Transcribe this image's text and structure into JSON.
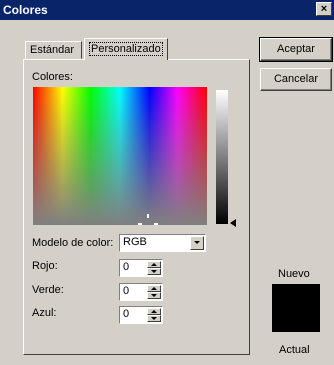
{
  "window": {
    "title": "Colores",
    "close_glyph": "×"
  },
  "tabs": [
    {
      "label": "Estándar",
      "active": false
    },
    {
      "label": "Personalizado",
      "active": true
    }
  ],
  "custom": {
    "colors_label": "Colores:",
    "model_label": "Modelo de color:",
    "model_value": "RGB",
    "red_label": "Rojo:",
    "green_label": "Verde:",
    "blue_label": "Azul:",
    "red_value": "0",
    "green_value": "0",
    "blue_value": "0"
  },
  "buttons": {
    "ok": "Aceptar",
    "cancel": "Cancelar"
  },
  "preview": {
    "new_label": "Nuevo",
    "current_label": "Actual",
    "current_color": "#000000",
    "new_color": "#000000"
  },
  "colors": {
    "titlebar": "#0a246a",
    "face": "#d4d0c8"
  }
}
